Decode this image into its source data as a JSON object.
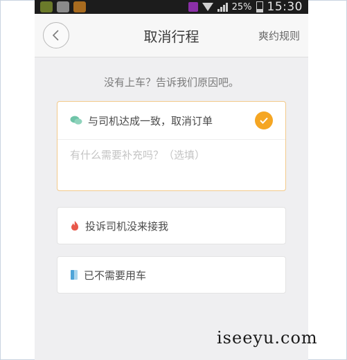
{
  "status_bar": {
    "battery": "25%",
    "time": "15:30"
  },
  "header": {
    "title": "取消行程",
    "rules": "爽约规则"
  },
  "prompt": "没有上车？告诉我们原因吧。",
  "options": [
    {
      "label": "与司机达成一致，取消订单",
      "icon": "chat-bubble-icon",
      "selected": true
    },
    {
      "label": "投诉司机没来接我",
      "icon": "flame-icon",
      "selected": false
    },
    {
      "label": "已不需要用车",
      "icon": "door-icon",
      "selected": false
    }
  ],
  "supplement": {
    "placeholder": "有什么需要补充吗？（选填）",
    "value": ""
  },
  "watermark": "iseeyu.com",
  "colors": {
    "accent": "#f5a623",
    "selected_border": "#f2c98a",
    "background": "#efeff1"
  }
}
